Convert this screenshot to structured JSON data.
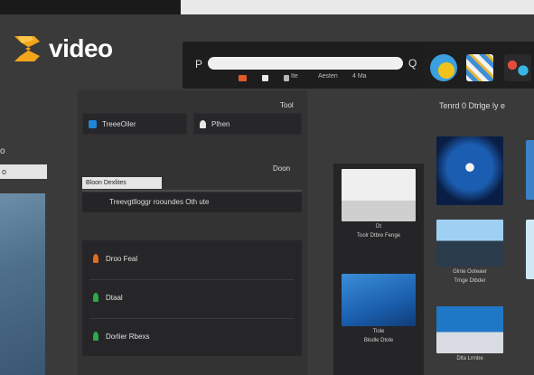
{
  "app": {
    "logo_text": "video",
    "brand_color": "#f2a51a"
  },
  "left_panel": {
    "label": "o",
    "input_value": "o"
  },
  "toolbar": {
    "left_glyph": "P",
    "right_glyph": "Q",
    "search_placeholder": "",
    "items": [
      {
        "icon": "folder-icon",
        "color": "#e05a2a"
      },
      {
        "icon": "doc-icon",
        "color": "#e8e8e8"
      },
      {
        "icon": "film-icon",
        "color": "#b8b8b8",
        "label": "Ite"
      },
      {
        "icon": "people-icon",
        "color": "#b8b8b8",
        "label": "Aesten"
      },
      {
        "icon": "chart-icon",
        "color": "#b8b8b8",
        "label": "4 Ma"
      }
    ]
  },
  "mid_panel": {
    "top_right_label": "Tool",
    "chips": [
      {
        "label": "TreeeOiler",
        "icon": "play-icon",
        "icon_color": "#1f86d6"
      },
      {
        "label": "Plhen",
        "icon": "person-icon",
        "icon_color": "#e6e6e6"
      }
    ],
    "section_right_label": "Doon",
    "section_input_label": "Bloon Dexlites",
    "section_field_text": "Treevgtlloggr rooundes Oth ute",
    "list_items": [
      {
        "label": "Droo Feal",
        "icon_color": "#e36b1e"
      },
      {
        "label": "Dtaal",
        "icon_color": "#2ea84a"
      },
      {
        "label": "Dorlier Rbexs",
        "icon_color": "#2ea84a"
      }
    ]
  },
  "gallery": {
    "heading": "Tenrd 0 Dtrlge ly e",
    "col1": [
      {
        "caption_line1": "Dt",
        "caption_line2": "Toolr Dtbre Fenge"
      },
      {
        "caption_line1": "Tlole",
        "caption_line2": "Blodle Dtole"
      }
    ],
    "col2": [
      {
        "caption_line1": "",
        "caption_line2": ""
      },
      {
        "caption_line1": "Glnte Ooteaer",
        "caption_line2": "Trnge Dtbder"
      },
      {
        "caption_line1": "Dlta Lrmbe",
        "caption_line2": ""
      }
    ]
  }
}
